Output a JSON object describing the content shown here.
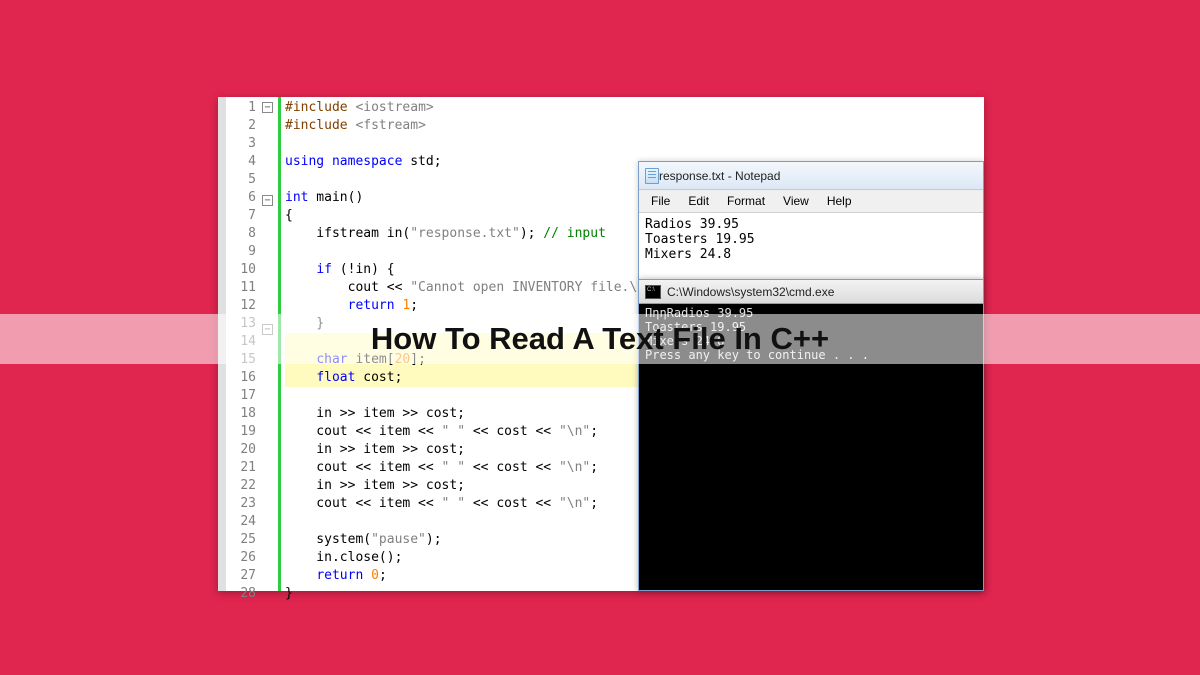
{
  "editor": {
    "lines": [
      {
        "n": 1,
        "fold": "-",
        "tokens": [
          {
            "t": "#include ",
            "c": "pp"
          },
          {
            "t": "<iostream>",
            "c": "str"
          }
        ]
      },
      {
        "n": 2,
        "tokens": [
          {
            "t": "#include ",
            "c": "pp"
          },
          {
            "t": "<fstream>",
            "c": "str"
          }
        ]
      },
      {
        "n": 3,
        "tokens": []
      },
      {
        "n": 4,
        "tokens": [
          {
            "t": "using namespace",
            "c": "kw"
          },
          {
            "t": " std;",
            "c": ""
          }
        ]
      },
      {
        "n": 5,
        "tokens": []
      },
      {
        "n": 6,
        "fold": "-",
        "tokens": [
          {
            "t": "int",
            "c": "kw"
          },
          {
            "t": " main()",
            "c": ""
          }
        ]
      },
      {
        "n": 7,
        "tokens": [
          {
            "t": "{",
            "c": ""
          }
        ]
      },
      {
        "n": 8,
        "tokens": [
          {
            "t": "    ifstream in(",
            "c": ""
          },
          {
            "t": "\"response.txt\"",
            "c": "str"
          },
          {
            "t": "); ",
            "c": ""
          },
          {
            "t": "// input",
            "c": "cmt"
          }
        ]
      },
      {
        "n": 9,
        "tokens": []
      },
      {
        "n": 10,
        "tokens": [
          {
            "t": "    ",
            "c": ""
          },
          {
            "t": "if",
            "c": "kw"
          },
          {
            "t": " (!in) {",
            "c": ""
          }
        ]
      },
      {
        "n": 11,
        "tokens": [
          {
            "t": "        cout << ",
            "c": ""
          },
          {
            "t": "\"Cannot open INVENTORY file.\\n\"",
            "c": "str"
          },
          {
            "t": ";",
            "c": ""
          }
        ]
      },
      {
        "n": 12,
        "tokens": [
          {
            "t": "        ",
            "c": ""
          },
          {
            "t": "return",
            "c": "kw"
          },
          {
            "t": " ",
            "c": ""
          },
          {
            "t": "1",
            "c": "num"
          },
          {
            "t": ";",
            "c": ""
          }
        ]
      },
      {
        "n": 13,
        "fold": "-",
        "tokens": [
          {
            "t": "    }",
            "c": ""
          }
        ]
      },
      {
        "n": 14,
        "hl": true,
        "tokens": []
      },
      {
        "n": 15,
        "hl": true,
        "tokens": [
          {
            "t": "    ",
            "c": ""
          },
          {
            "t": "char",
            "c": "kw"
          },
          {
            "t": " item[",
            "c": ""
          },
          {
            "t": "20",
            "c": "num"
          },
          {
            "t": "];",
            "c": ""
          }
        ]
      },
      {
        "n": 16,
        "hl": true,
        "tokens": [
          {
            "t": "    ",
            "c": ""
          },
          {
            "t": "float",
            "c": "kw"
          },
          {
            "t": " cost;",
            "c": ""
          }
        ]
      },
      {
        "n": 17,
        "tokens": []
      },
      {
        "n": 18,
        "tokens": [
          {
            "t": "    in >> item >> cost;",
            "c": ""
          }
        ]
      },
      {
        "n": 19,
        "tokens": [
          {
            "t": "    cout << item << ",
            "c": ""
          },
          {
            "t": "\" \"",
            "c": "str"
          },
          {
            "t": " << cost << ",
            "c": ""
          },
          {
            "t": "\"\\n\"",
            "c": "str"
          },
          {
            "t": ";",
            "c": ""
          }
        ]
      },
      {
        "n": 20,
        "tokens": [
          {
            "t": "    in >> item >> cost;",
            "c": ""
          }
        ]
      },
      {
        "n": 21,
        "tokens": [
          {
            "t": "    cout << item << ",
            "c": ""
          },
          {
            "t": "\" \"",
            "c": "str"
          },
          {
            "t": " << cost << ",
            "c": ""
          },
          {
            "t": "\"\\n\"",
            "c": "str"
          },
          {
            "t": ";",
            "c": ""
          }
        ]
      },
      {
        "n": 22,
        "tokens": [
          {
            "t": "    in >> item >> cost;",
            "c": ""
          }
        ]
      },
      {
        "n": 23,
        "tokens": [
          {
            "t": "    cout << item << ",
            "c": ""
          },
          {
            "t": "\" \"",
            "c": "str"
          },
          {
            "t": " << cost << ",
            "c": ""
          },
          {
            "t": "\"\\n\"",
            "c": "str"
          },
          {
            "t": ";",
            "c": ""
          }
        ]
      },
      {
        "n": 24,
        "tokens": []
      },
      {
        "n": 25,
        "tokens": [
          {
            "t": "    system(",
            "c": ""
          },
          {
            "t": "\"pause\"",
            "c": "str"
          },
          {
            "t": ");",
            "c": ""
          }
        ]
      },
      {
        "n": 26,
        "tokens": [
          {
            "t": "    in.close();",
            "c": ""
          }
        ]
      },
      {
        "n": 27,
        "tokens": [
          {
            "t": "    ",
            "c": ""
          },
          {
            "t": "return",
            "c": "kw"
          },
          {
            "t": " ",
            "c": ""
          },
          {
            "t": "0",
            "c": "num"
          },
          {
            "t": ";",
            "c": ""
          }
        ]
      },
      {
        "n": 28,
        "tokens": [
          {
            "t": "}",
            "c": ""
          }
        ]
      }
    ]
  },
  "notepad": {
    "title": "response.txt - Notepad",
    "menu": [
      "File",
      "Edit",
      "Format",
      "View",
      "Help"
    ],
    "lines": [
      "Radios 39.95",
      "Toasters 19.95",
      "Mixers 24.8"
    ]
  },
  "cmd": {
    "title": "C:\\Windows\\system32\\cmd.exe",
    "lines": [
      "ΠηηRadios 39.95",
      "Toasters 19.95",
      "Mixers 24.8",
      "Press any key to continue . . ."
    ]
  },
  "banner": {
    "title": "How To Read A Text File In C++"
  }
}
